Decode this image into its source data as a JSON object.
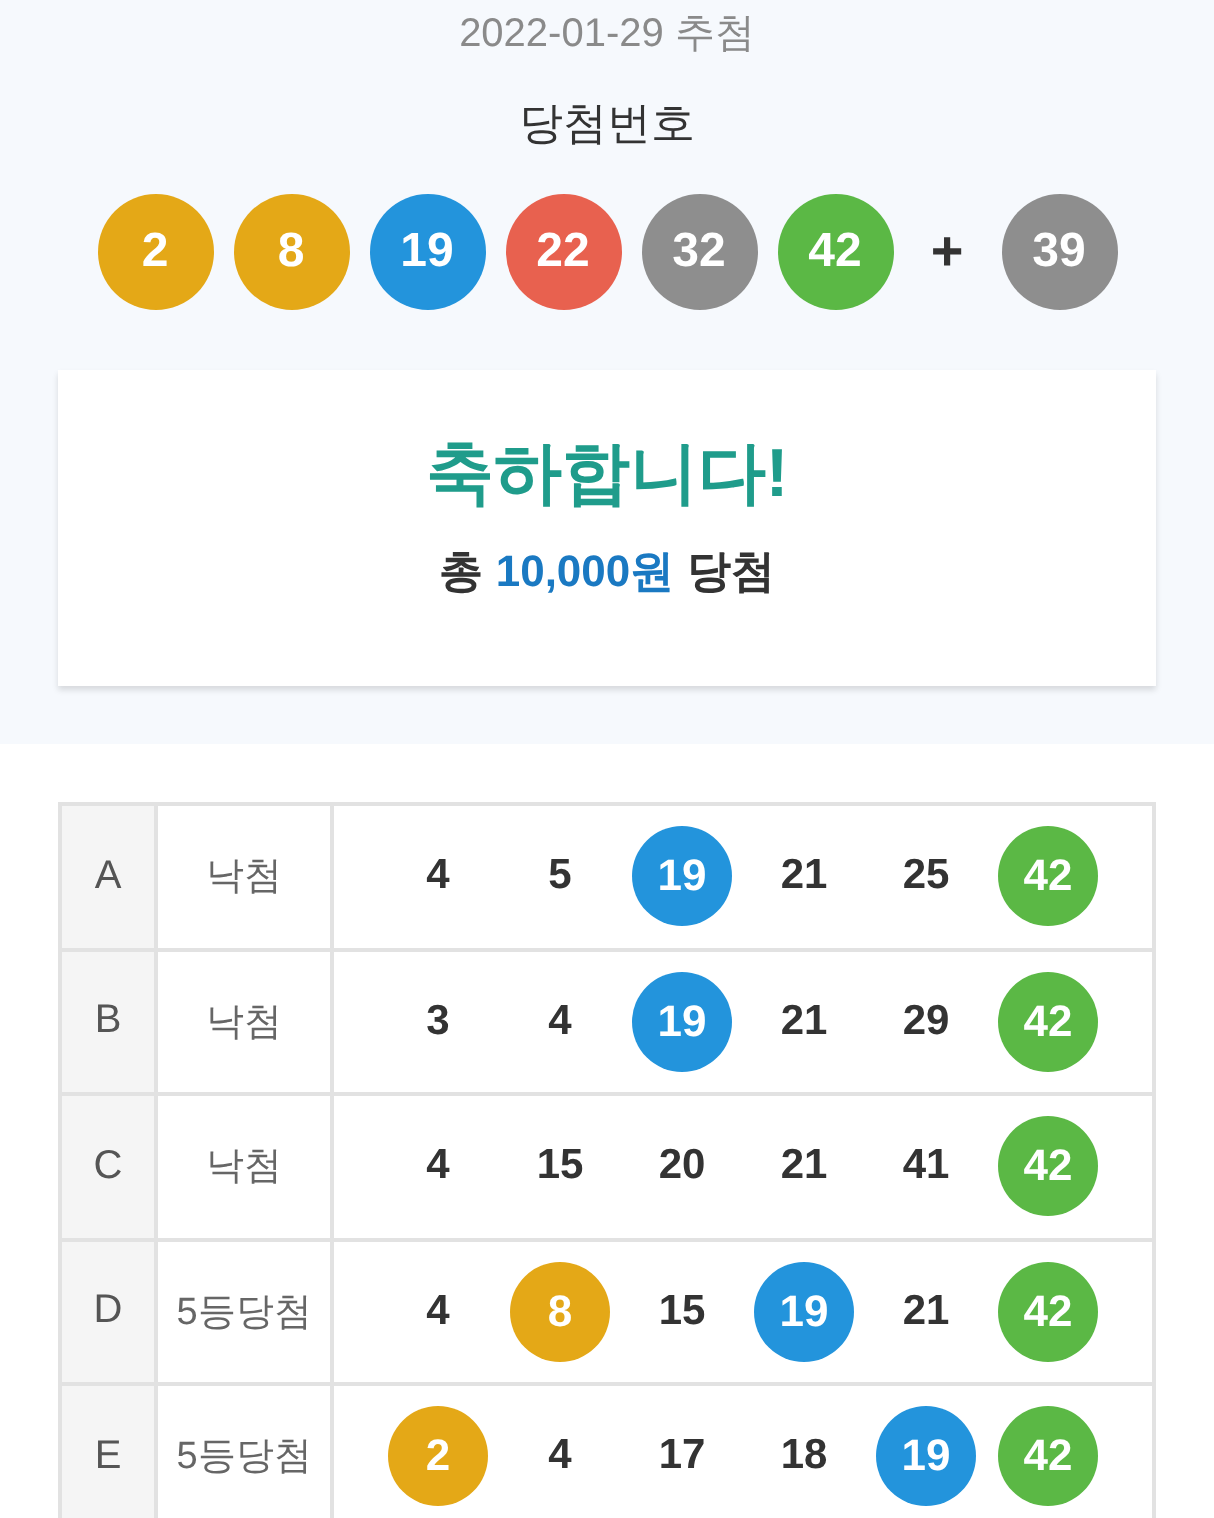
{
  "draw": {
    "date": "2022-01-29 추첨",
    "title": "당첨번호",
    "numbers": [
      {
        "value": "2",
        "color": "#e4a817"
      },
      {
        "value": "8",
        "color": "#e4a817"
      },
      {
        "value": "19",
        "color": "#2394dc"
      },
      {
        "value": "22",
        "color": "#e8614f"
      },
      {
        "value": "32",
        "color": "#8e8e8e"
      },
      {
        "value": "42",
        "color": "#5bb845"
      }
    ],
    "plus": "+",
    "bonus": {
      "value": "39",
      "color": "#8e8e8e"
    }
  },
  "result": {
    "headline": "축하합니다!",
    "summary_prefix": "총",
    "amount": "10,000원",
    "summary_suffix": "당첨"
  },
  "rows": [
    {
      "label": "A",
      "result": "낙첨",
      "numbers": [
        {
          "value": "4",
          "matched": false
        },
        {
          "value": "5",
          "matched": false
        },
        {
          "value": "19",
          "matched": true,
          "color": "#2394dc"
        },
        {
          "value": "21",
          "matched": false
        },
        {
          "value": "25",
          "matched": false
        },
        {
          "value": "42",
          "matched": true,
          "color": "#5bb845"
        }
      ]
    },
    {
      "label": "B",
      "result": "낙첨",
      "numbers": [
        {
          "value": "3",
          "matched": false
        },
        {
          "value": "4",
          "matched": false
        },
        {
          "value": "19",
          "matched": true,
          "color": "#2394dc"
        },
        {
          "value": "21",
          "matched": false
        },
        {
          "value": "29",
          "matched": false
        },
        {
          "value": "42",
          "matched": true,
          "color": "#5bb845"
        }
      ]
    },
    {
      "label": "C",
      "result": "낙첨",
      "numbers": [
        {
          "value": "4",
          "matched": false
        },
        {
          "value": "15",
          "matched": false
        },
        {
          "value": "20",
          "matched": false
        },
        {
          "value": "21",
          "matched": false
        },
        {
          "value": "41",
          "matched": false
        },
        {
          "value": "42",
          "matched": true,
          "color": "#5bb845"
        }
      ]
    },
    {
      "label": "D",
      "result": "5등당첨",
      "numbers": [
        {
          "value": "4",
          "matched": false
        },
        {
          "value": "8",
          "matched": true,
          "color": "#e4a817"
        },
        {
          "value": "15",
          "matched": false
        },
        {
          "value": "19",
          "matched": true,
          "color": "#2394dc"
        },
        {
          "value": "21",
          "matched": false
        },
        {
          "value": "42",
          "matched": true,
          "color": "#5bb845"
        }
      ]
    },
    {
      "label": "E",
      "result": "5등당첨",
      "numbers": [
        {
          "value": "2",
          "matched": true,
          "color": "#e4a817"
        },
        {
          "value": "4",
          "matched": false
        },
        {
          "value": "17",
          "matched": false
        },
        {
          "value": "18",
          "matched": false
        },
        {
          "value": "19",
          "matched": true,
          "color": "#2394dc"
        },
        {
          "value": "42",
          "matched": true,
          "color": "#5bb845"
        }
      ]
    }
  ]
}
